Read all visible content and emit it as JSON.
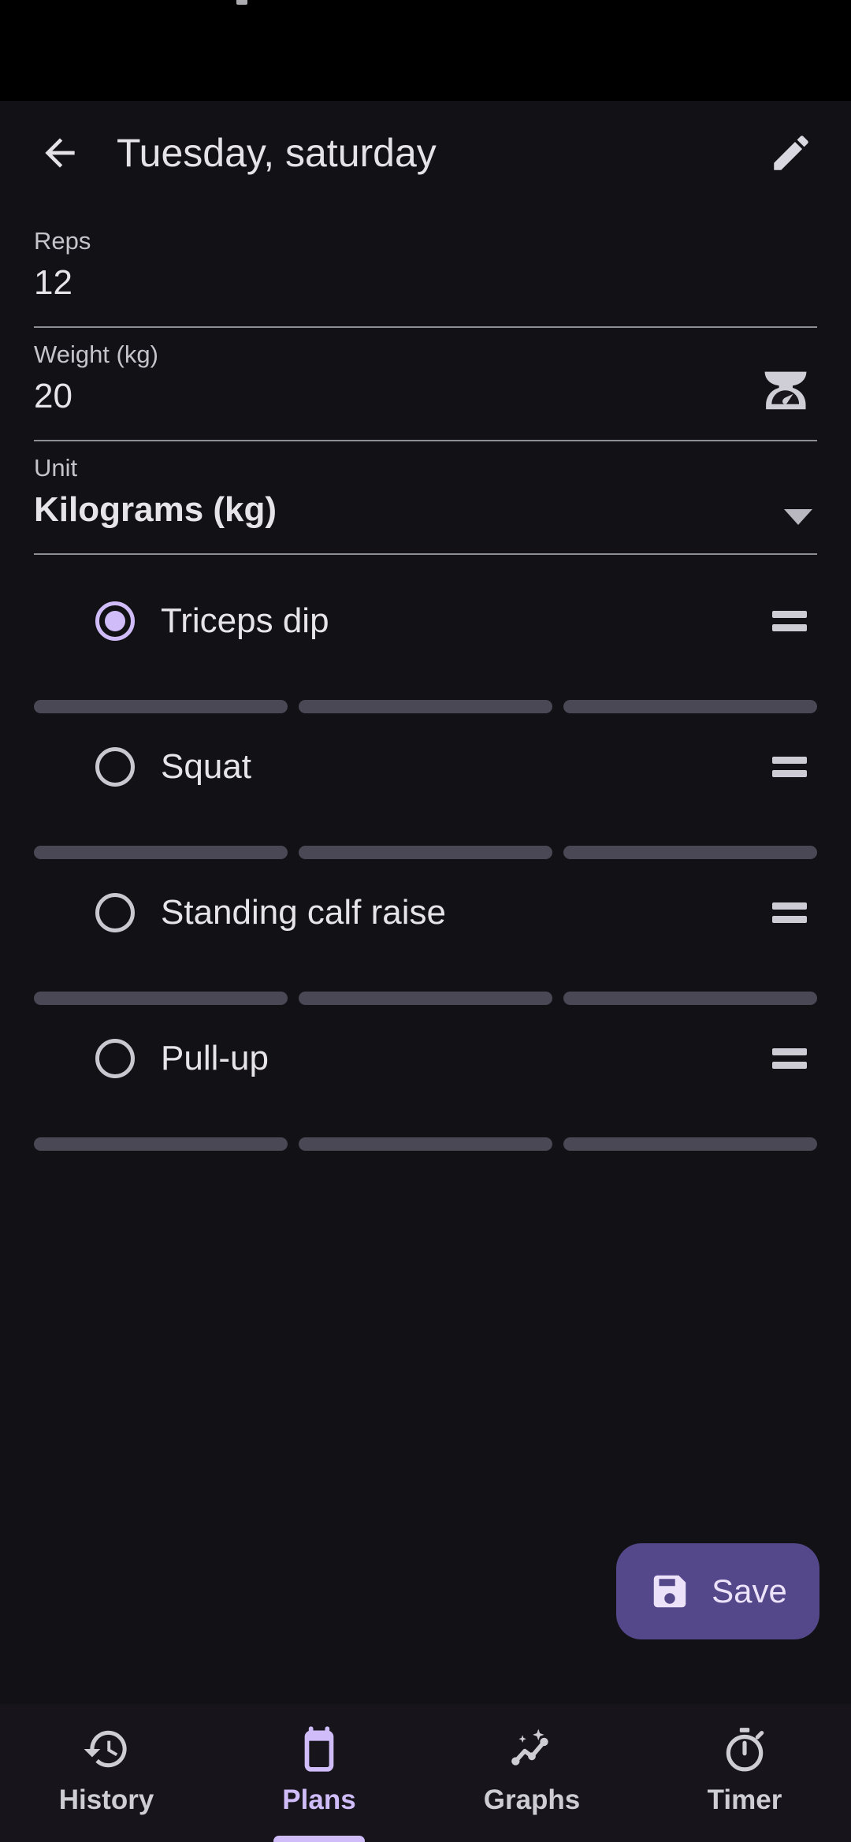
{
  "statusbar": {
    "icon": "partial-glyph"
  },
  "appbar": {
    "back_icon": "arrow-left-icon",
    "title": "Tuesday, saturday",
    "edit_icon": "pencil-icon"
  },
  "form": {
    "fields": [
      {
        "label": "Reps",
        "value": "12",
        "trailing_icon": ""
      },
      {
        "label": "Weight (kg)",
        "value": "20",
        "trailing_icon": "weight-scale-icon"
      },
      {
        "label": "Unit",
        "value": "Kilograms (kg)",
        "trailing_icon": "dropdown-arrow-icon"
      }
    ]
  },
  "exercises": [
    {
      "name": "Triceps dip",
      "selected": true,
      "handle_icon": "drag-handle-icon",
      "bars": 3
    },
    {
      "name": "Squat",
      "selected": false,
      "handle_icon": "drag-handle-icon",
      "bars": 3
    },
    {
      "name": "Standing calf raise",
      "selected": false,
      "handle_icon": "drag-handle-icon",
      "bars": 3
    },
    {
      "name": "Pull-up",
      "selected": false,
      "handle_icon": "drag-handle-icon",
      "bars": 3
    }
  ],
  "save": {
    "label": "Save",
    "icon": "floppy-disk-icon"
  },
  "bottom_nav": {
    "items": [
      {
        "label": "History",
        "icon": "history-clock-icon",
        "active": false
      },
      {
        "label": "Plans",
        "icon": "calendar-icon",
        "active": true
      },
      {
        "label": "Graphs",
        "icon": "chart-sparkle-icon",
        "active": false
      },
      {
        "label": "Timer",
        "icon": "stopwatch-icon",
        "active": false
      }
    ]
  },
  "colors": {
    "background": "#121216",
    "surface": "#17151b",
    "accent": "#cfbcf8",
    "fab": "#54478a",
    "text_primary": "#e6e4e9",
    "text_secondary": "#c6c4cb",
    "bar": "#4a4854"
  }
}
